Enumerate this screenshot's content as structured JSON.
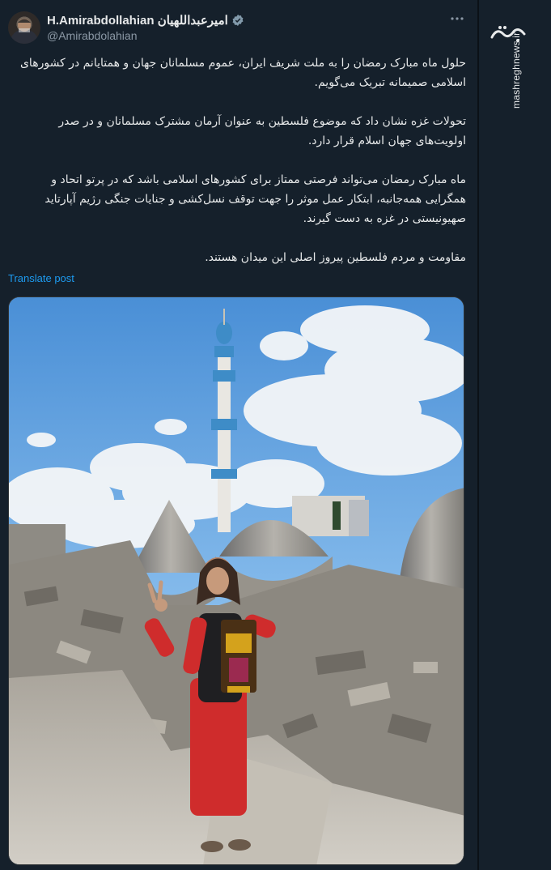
{
  "author": {
    "display_name": "H.Amirabdollahian امیرعبداللهیان",
    "handle": "@Amirabdolahian",
    "verified": true
  },
  "post": {
    "paragraphs": [
      "حلول ماه مبارک رمضان را به ملت شریف ایران، عموم مسلمانان جهان و همتایانم در کشورهای اسلامی صمیمانه تبریک می‌گویم.",
      "تحولات غزه نشان داد که موضوع فلسطین به عنوان آرمان مشترک مسلمانان و در صدر اولویت‌های جهان اسلام قرار دارد.",
      "ماه مبارک رمضان می‌تواند فرصتی ممتاز برای کشورهای اسلامی باشد که در پرتو اتحاد و همگرایی همه‌جانبه، ابتکار عمل موثر را جهت توقف نسل‌کشی و جنایات جنگی رژیم آپارتاید صهیونیستی در غزه به دست گیرند.",
      "مقاومت و مردم فلسطین پیروز اصلی این میدان هستند."
    ],
    "translate_label": "Translate post"
  },
  "icons": {
    "more": "more-options-icon",
    "verified": "verified-badge-icon"
  },
  "watermark": {
    "logo_text": "مشرق",
    "site": "mashreghnews.ir"
  },
  "colors": {
    "background": "#15202b",
    "link": "#1d9bf0",
    "verified_badge": "#829aab"
  }
}
